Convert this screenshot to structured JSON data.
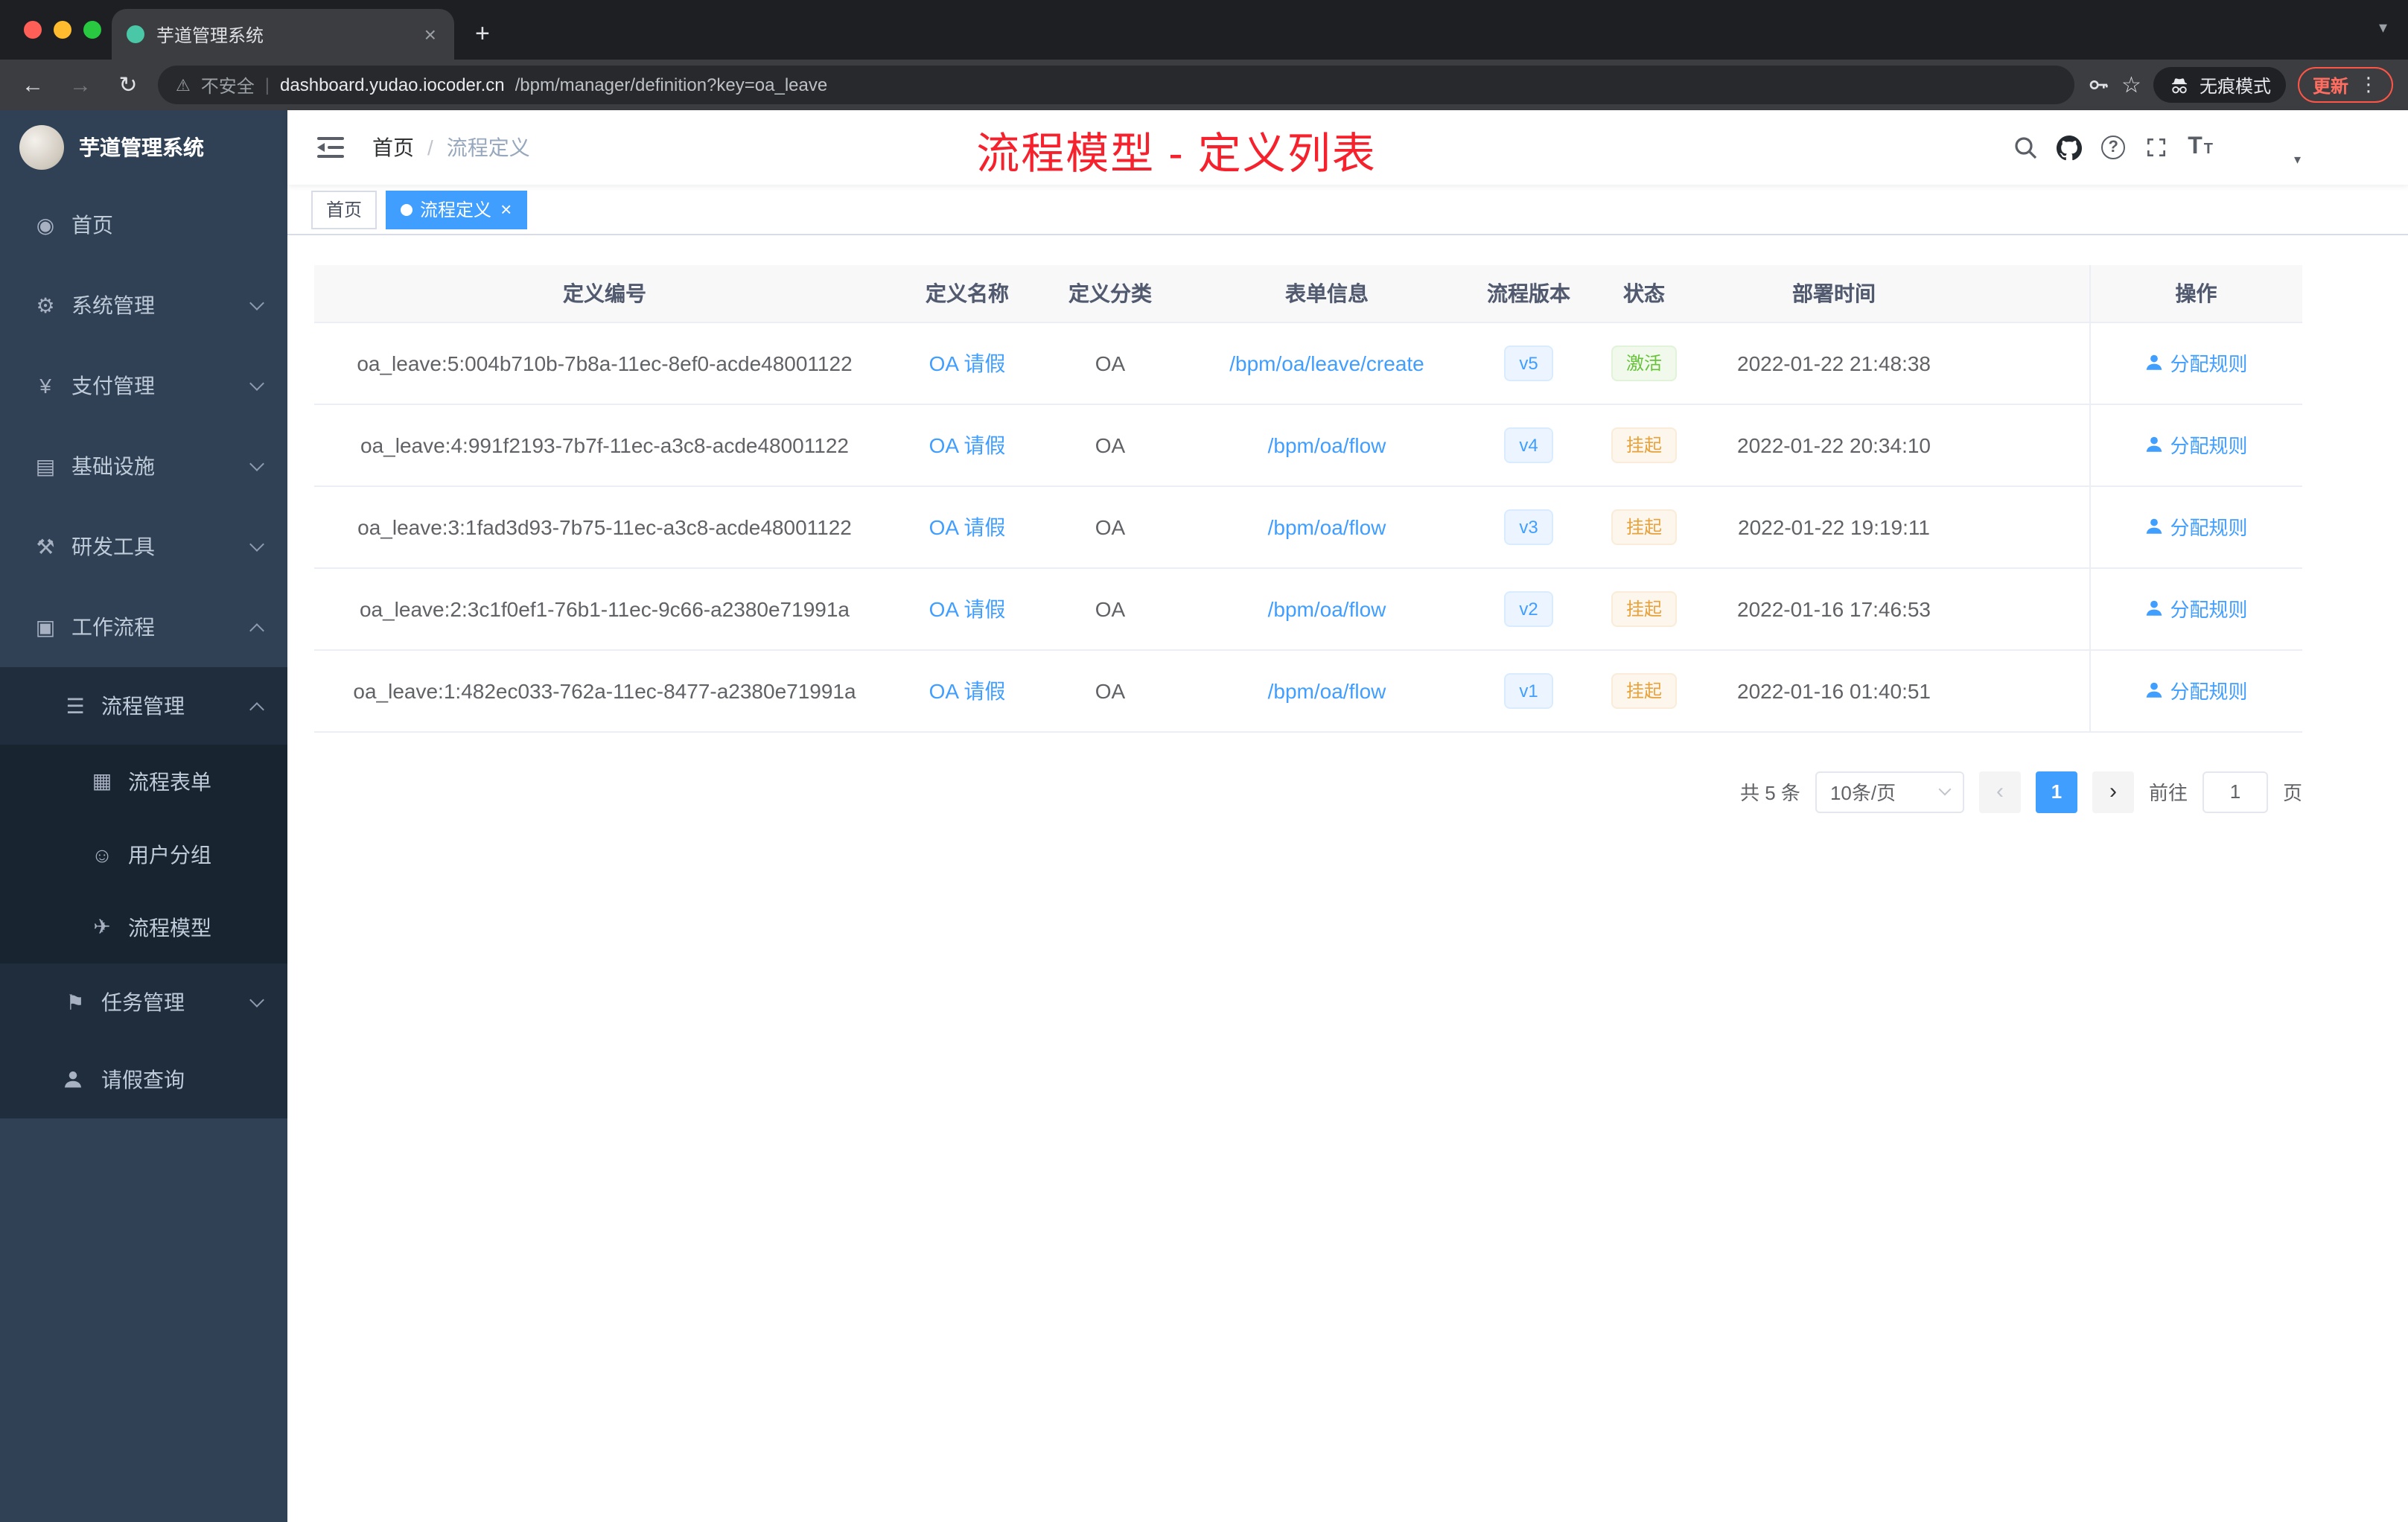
{
  "browser": {
    "tab_title": "芋道管理系统",
    "new_tab": "+",
    "close": "×",
    "tab_caret": "▾",
    "back": "←",
    "forward": "→",
    "reload": "↻",
    "warning": "⚠",
    "not_secure": "不安全",
    "divider": "|",
    "url_domain": "dashboard.yudao.iocoder.cn",
    "url_path": "/bpm/manager/definition?key=oa_leave",
    "star": "☆",
    "incognito_label": "无痕模式",
    "update_label": "更新",
    "menu_dots": "⋮"
  },
  "sidebar": {
    "logo_title": "芋道管理系统",
    "items": [
      {
        "glyph": "◉",
        "label": "首页"
      },
      {
        "glyph": "⚙",
        "label": "系统管理"
      },
      {
        "glyph": "¥",
        "label": "支付管理"
      },
      {
        "glyph": "▤",
        "label": "基础设施"
      },
      {
        "glyph": "⚒",
        "label": "研发工具"
      },
      {
        "glyph": "▣",
        "label": "工作流程"
      },
      {
        "glyph": "☰",
        "label": "流程管理"
      },
      {
        "glyph": "▦",
        "label": "流程表单"
      },
      {
        "glyph": "☺",
        "label": "用户分组"
      },
      {
        "glyph": "✈",
        "label": "流程模型"
      },
      {
        "glyph": "⚑",
        "label": "任务管理"
      },
      {
        "glyph": "",
        "label": "请假查询"
      }
    ]
  },
  "header": {
    "breadcrumb": [
      "首页",
      "流程定义"
    ],
    "breadcrumb_sep": "/",
    "annotation": "流程模型 - 定义列表",
    "question": "?",
    "font_icon_big": "T",
    "font_icon_small": "T",
    "avatar_caret": "▾"
  },
  "tags": [
    {
      "label": "首页"
    },
    {
      "label": "流程定义",
      "close": "×"
    }
  ],
  "table": {
    "headers": [
      "定义编号",
      "定义名称",
      "定义分类",
      "表单信息",
      "流程版本",
      "状态",
      "部署时间",
      "操作"
    ],
    "rows": [
      {
        "id": "oa_leave:5:004b710b-7b8a-11ec-8ef0-acde48001122",
        "name": "OA 请假",
        "category": "OA",
        "form": "/bpm/oa/leave/create",
        "version": "v5",
        "status": "激活",
        "status_type": "success",
        "time": "2022-01-22 21:48:38",
        "action": "分配规则"
      },
      {
        "id": "oa_leave:4:991f2193-7b7f-11ec-a3c8-acde48001122",
        "name": "OA 请假",
        "category": "OA",
        "form": "/bpm/oa/flow",
        "version": "v4",
        "status": "挂起",
        "status_type": "warning",
        "time": "2022-01-22 20:34:10",
        "action": "分配规则"
      },
      {
        "id": "oa_leave:3:1fad3d93-7b75-11ec-a3c8-acde48001122",
        "name": "OA 请假",
        "category": "OA",
        "form": "/bpm/oa/flow",
        "version": "v3",
        "status": "挂起",
        "status_type": "warning",
        "time": "2022-01-22 19:19:11",
        "action": "分配规则"
      },
      {
        "id": "oa_leave:2:3c1f0ef1-76b1-11ec-9c66-a2380e71991a",
        "name": "OA 请假",
        "category": "OA",
        "form": "/bpm/oa/flow",
        "version": "v2",
        "status": "挂起",
        "status_type": "warning",
        "time": "2022-01-16 17:46:53",
        "action": "分配规则"
      },
      {
        "id": "oa_leave:1:482ec033-762a-11ec-8477-a2380e71991a",
        "name": "OA 请假",
        "category": "OA",
        "form": "/bpm/oa/flow",
        "version": "v1",
        "status": "挂起",
        "status_type": "warning",
        "time": "2022-01-16 01:40:51",
        "action": "分配规则"
      }
    ]
  },
  "pagination": {
    "total": "共 5 条",
    "page_size": "10条/页",
    "prev": "‹",
    "next": "›",
    "current": "1",
    "goto_label": "前往",
    "goto_value": "1",
    "unit_label": "页"
  },
  "colors": {
    "accent": "#409eff",
    "annotation": "#f5222d",
    "success": "#67c23a",
    "warning": "#e6a23c",
    "sidebar_bg": "#304156"
  }
}
